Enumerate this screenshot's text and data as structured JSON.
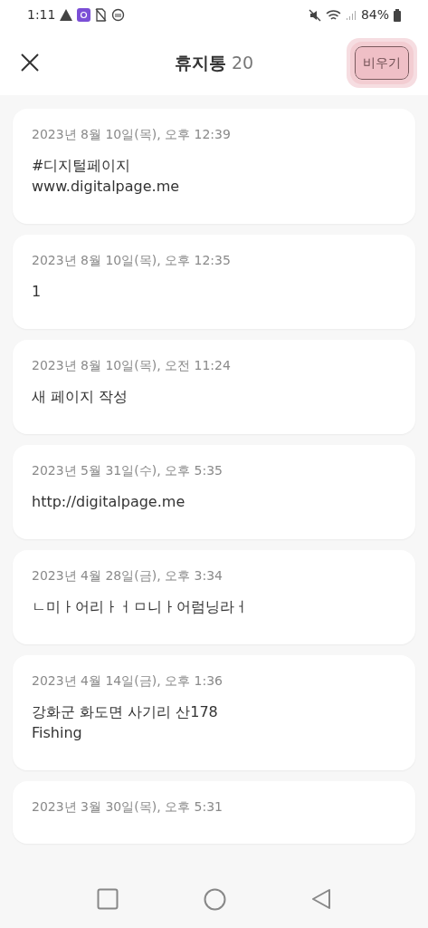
{
  "status_bar": {
    "time": "1:11",
    "battery": "84%"
  },
  "header": {
    "title": "휴지통",
    "count": "20",
    "empty_button": "비우기",
    "empty_button_pressed": true
  },
  "notes": [
    {
      "date": "2023년 8월 10일(목), 오후 12:39",
      "lines": [
        "#디지털페이지",
        "www.digitalpage.me"
      ]
    },
    {
      "date": "2023년 8월 10일(목), 오후 12:35",
      "lines": [
        "1"
      ]
    },
    {
      "date": "2023년 8월 10일(목), 오전 11:24",
      "lines": [
        "새 페이지 작성"
      ]
    },
    {
      "date": "2023년 5월 31일(수), 오후 5:35",
      "lines": [
        "http://digitalpage.me"
      ]
    },
    {
      "date": "2023년 4월 28일(금), 오후 3:34",
      "lines": [
        "ㄴ미ㅏ어리ㅏㅓㅁ니ㅏ어럼닝라ㅓ"
      ]
    },
    {
      "date": "2023년 4월 14일(금), 오후 1:36",
      "lines": [
        "강화군 화도면 사기리 산178",
        "Fishing"
      ]
    },
    {
      "date": "2023년 3월 30일(목), 오후 5:31"
    }
  ]
}
